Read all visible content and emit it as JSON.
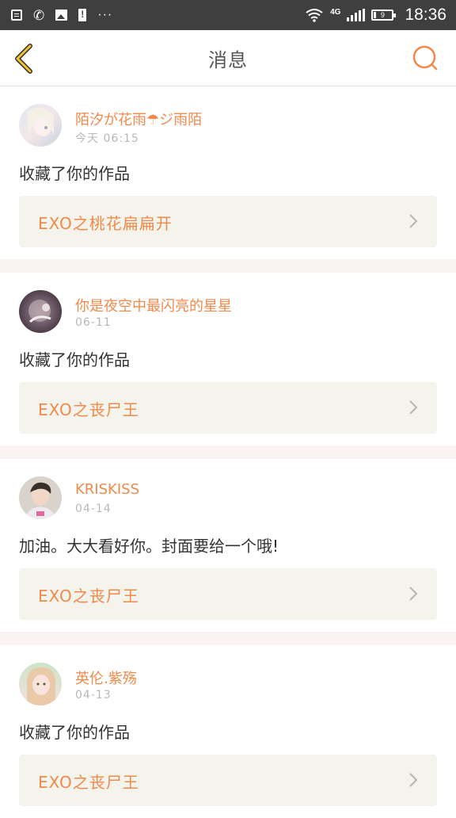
{
  "status_bar": {
    "time": "18:36",
    "network": "4G",
    "battery": "9",
    "more": "···",
    "left_icons": [
      "message-icon",
      "missed-call-icon",
      "image-icon",
      "battery-alert-icon",
      "more-icon"
    ],
    "right_icons": [
      "wifi-icon",
      "signal-icon",
      "battery-icon"
    ]
  },
  "header": {
    "title": "消息",
    "back_icon": "chevron-left-icon",
    "search_icon": "search-icon",
    "accent_color": "#f08a4b",
    "back_color": "#f2c12e"
  },
  "messages": [
    {
      "username": "陌汐が花雨☂ジ雨陌",
      "time": "今天 06:15",
      "content": "收藏了你的作品",
      "work_title": "EXO之桃花扁扁开"
    },
    {
      "username": "你是夜空中最闪亮的星星",
      "time": "06-11",
      "content": "收藏了你的作品",
      "work_title": "EXO之丧尸王"
    },
    {
      "username": "KRISKISS",
      "time": "04-14",
      "content": "加油。大大看好你。封面要给一个哦!",
      "work_title": "EXO之丧尸王"
    },
    {
      "username": "英伦.紫殇",
      "time": "04-13",
      "content": "收藏了你的作品",
      "work_title": "EXO之丧尸王"
    }
  ],
  "colors": {
    "name": "#f08a4b",
    "time": "#b8b8b8",
    "content": "#333333",
    "work_box_bg": "#f4f3ec",
    "separator": "#fbf3f3",
    "status_bar_bg": "#3f3f3f"
  }
}
